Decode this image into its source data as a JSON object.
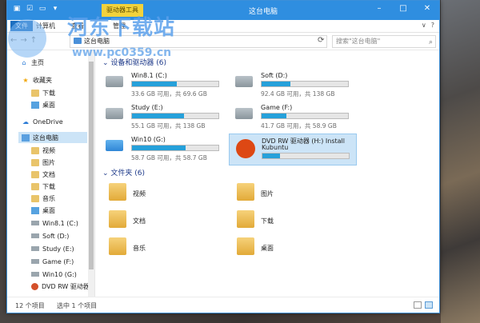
{
  "window": {
    "title": "这台电脑",
    "context_tab": "驱动器工具",
    "controls": [
      "–",
      "□",
      "✕"
    ]
  },
  "ribbon": {
    "file": "文件",
    "tabs": [
      "计算机",
      "查看",
      "管理"
    ],
    "right": [
      "∨",
      "?"
    ]
  },
  "address": {
    "back": "←",
    "forward": "→",
    "up": "↑",
    "path": "这台电脑",
    "search_placeholder": "搜索\"这台电脑\""
  },
  "nav": {
    "home": "主页",
    "favorites": "收藏夹",
    "fav_items": [
      "下载",
      "桌面"
    ],
    "onedrive": "OneDrive",
    "this_pc": "这台电脑",
    "pc_items": [
      "视频",
      "图片",
      "文档",
      "下载",
      "音乐",
      "桌面"
    ],
    "drives": [
      "Win8.1 (C:)",
      "Soft (D:)",
      "Study (E:)",
      "Game (F:)",
      "Win10 (G:)",
      "DVD RW 驱动器"
    ]
  },
  "devices": {
    "header": "设备和驱动器 (6)",
    "items": [
      {
        "name": "Win8.1 (C:)",
        "free": "33.6 GB 可用，共 69.6 GB",
        "used_fraction": 0.52
      },
      {
        "name": "Soft (D:)",
        "free": "92.4 GB 可用，共 138 GB",
        "used_fraction": 0.33
      },
      {
        "name": "Study (E:)",
        "free": "55.1 GB 可用，共 138 GB",
        "used_fraction": 0.6
      },
      {
        "name": "Game (F:)",
        "free": "41.7 GB 可用，共 58.9 GB",
        "used_fraction": 0.29
      },
      {
        "name": "Win10 (G:)",
        "free": "58.7 GB 可用，共 58.7 GB",
        "used_fraction": 0.62
      },
      {
        "name": "DVD RW 驱动器 (H:) Install",
        "name2": "Kubuntu",
        "used_fraction": 0.2
      }
    ]
  },
  "folders": {
    "header": "文件夹 (6)",
    "items": [
      "视频",
      "图片",
      "文档",
      "下载",
      "音乐",
      "桌面"
    ]
  },
  "status": {
    "count": "12 个项目",
    "selected": "选中 1 个项目"
  },
  "watermark": {
    "text": "河东下载站",
    "url": "www.pc0359.cn"
  },
  "colors": {
    "titlebar": "#2f8ee0",
    "context_tab": "#f2d23c",
    "bar_fill": "#26a0da",
    "selection": "#cce4f7"
  }
}
